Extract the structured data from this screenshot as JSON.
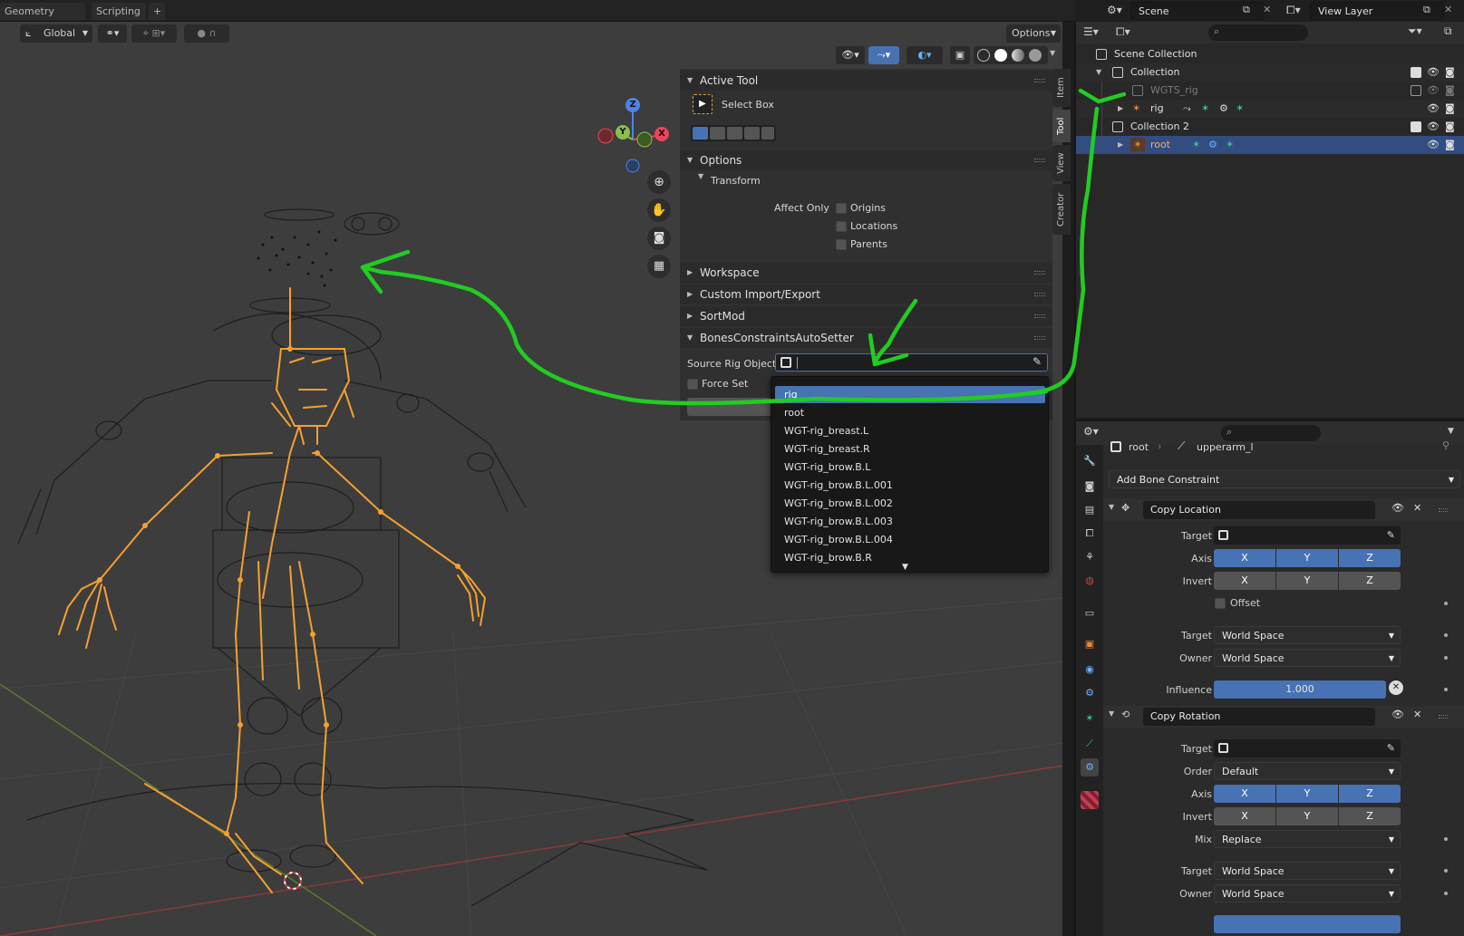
{
  "workspace_tabs": [
    {
      "label": "Geometry Nodes"
    },
    {
      "label": "Scripting"
    },
    {
      "label": "+"
    }
  ],
  "viewport_header": {
    "orientation": "Global",
    "options_label": "Options"
  },
  "gizmo_axes": {
    "x": "X",
    "y": "Y",
    "z": "Z"
  },
  "npanel": {
    "active_tool": {
      "header": "Active Tool",
      "tool_name": "Select Box"
    },
    "options": {
      "header": "Options",
      "transform_header": "Transform",
      "affect_only_label": "Affect Only",
      "checkboxes": [
        "Origins",
        "Locations",
        "Parents"
      ]
    },
    "workspace_header": "Workspace",
    "custom_import_header": "Custom Import/Export",
    "sortmod_header": "SortMod",
    "bones_header": "BonesConstraintsAutoSetter",
    "source_rig_label": "Source Rig Object:",
    "force_set_label": "Force Set",
    "side_tabs": [
      "Item",
      "Tool",
      "View",
      "Creator"
    ]
  },
  "dropdown": {
    "items": [
      "rig",
      "root",
      "WGT-rig_breast.L",
      "WGT-rig_breast.R",
      "WGT-rig_brow.B.L",
      "WGT-rig_brow.B.L.001",
      "WGT-rig_brow.B.L.002",
      "WGT-rig_brow.B.L.003",
      "WGT-rig_brow.B.L.004",
      "WGT-rig_brow.B.R"
    ],
    "selected_index": 0
  },
  "scene_header": {
    "scene": "Scene",
    "view_layer": "View Layer"
  },
  "outliner": {
    "rows": [
      {
        "label": "Scene Collection"
      },
      {
        "label": "Collection"
      },
      {
        "label": "WGTS_rig"
      },
      {
        "label": "rig"
      },
      {
        "label": "Collection 2"
      },
      {
        "label": "root"
      }
    ]
  },
  "properties": {
    "breadcrumb_object": "root",
    "breadcrumb_bone": "upperarm_l",
    "add_constraint_label": "Add Bone Constraint",
    "copy_location": {
      "name": "Copy Location",
      "target_label": "Target",
      "axis_label": "Axis",
      "invert_label": "Invert",
      "offset_label": "Offset",
      "target_space_label": "Target",
      "target_space": "World Space",
      "owner_space_label": "Owner",
      "owner_space": "World Space",
      "influence_label": "Influence",
      "influence": "1.000",
      "axis_x": "X",
      "axis_y": "Y",
      "axis_z": "Z"
    },
    "copy_rotation": {
      "name": "Copy Rotation",
      "target_label": "Target",
      "order_label": "Order",
      "order": "Default",
      "axis_label": "Axis",
      "invert_label": "Invert",
      "mix_label": "Mix",
      "mix": "Replace",
      "target_space_label": "Target",
      "target_space": "World Space",
      "owner_space_label": "Owner",
      "owner_space": "World Space",
      "axis_x": "X",
      "axis_y": "Y",
      "axis_z": "Z"
    }
  },
  "colors": {
    "accent": "#4772b3",
    "bone_orange": "#f5a030",
    "annotation_green": "#22cc22",
    "selected_row": "#334d80"
  }
}
